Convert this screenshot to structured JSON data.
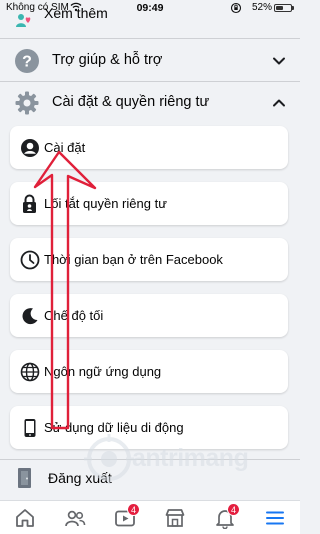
{
  "status_bar": {
    "carrier": "Không có SIM",
    "time": "09:49",
    "battery_percent": "52%",
    "battery_level": 0.52
  },
  "menu": {
    "see_more_label": "Xem thêm",
    "help_label": "Trợ giúp & hỗ trợ",
    "settings_privacy_label": "Cài đặt & quyền riêng tư",
    "items": [
      {
        "label": "Cài đặt",
        "icon": "user-circle-icon"
      },
      {
        "label": "Lối tắt quyền riêng tư",
        "icon": "privacy-lock-icon"
      },
      {
        "label": "Thời gian bạn ở trên Facebook",
        "icon": "clock-icon"
      },
      {
        "label": "Chế độ tối",
        "icon": "moon-icon"
      },
      {
        "label": "Ngôn ngữ ứng dụng",
        "icon": "globe-icon"
      },
      {
        "label": "Sử dụng dữ liệu di động",
        "icon": "phone-icon"
      }
    ],
    "logout_label": "Đăng xuất"
  },
  "watermark": {
    "text": "antrimang"
  },
  "tab_bar": {
    "tabs": [
      {
        "name": "home",
        "icon": "home-icon",
        "badge": ""
      },
      {
        "name": "friends",
        "icon": "friends-icon",
        "badge": ""
      },
      {
        "name": "watch",
        "icon": "video-icon",
        "badge": "4"
      },
      {
        "name": "marketplace",
        "icon": "store-icon",
        "badge": ""
      },
      {
        "name": "notifications",
        "icon": "bell-icon",
        "badge": "4"
      },
      {
        "name": "menu",
        "icon": "menu-icon",
        "badge": ""
      }
    ]
  },
  "colors": {
    "accent": "#1877f2",
    "arrow": "#e0203a",
    "badge": "#e41e3f",
    "background": "#f0f2f5"
  }
}
